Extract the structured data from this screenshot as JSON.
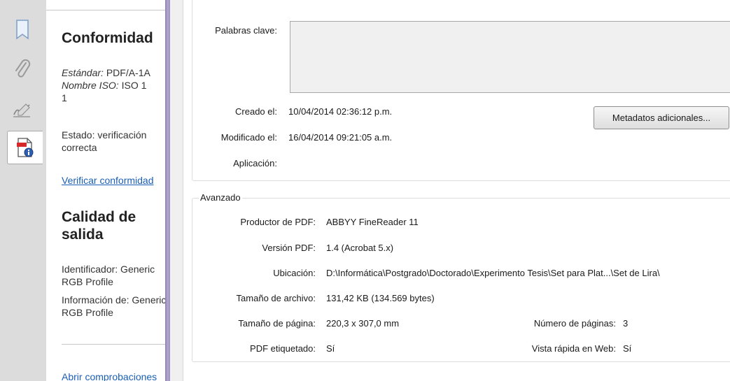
{
  "sidebar_panel": {
    "conformity_title": "Conformidad",
    "standard_label": "Estándar:",
    "standard_value": " PDF/A-1A",
    "iso_label": "Nombre ISO:",
    "iso_value": " ISO 1",
    "iso_cont": "1",
    "status_line1": "Estado: verificación",
    "status_line2": "correcta",
    "verify_link": "Verificar conformidad",
    "quality_title_l1": "Calidad de",
    "quality_title_l2": "salida",
    "identifier_l1": "Identificador: Generic",
    "identifier_l2": "RGB Profile",
    "info_l1": "Información de: Generic",
    "info_l2": "RGB Profile",
    "open_checks_link": "Abrir comprobaciones"
  },
  "properties": {
    "keywords_label": "Palabras clave:",
    "created_label": "Creado el:",
    "created_value": "10/04/2014 02:36:12 p.m.",
    "modified_label": "Modificado el:",
    "modified_value": "16/04/2014 09:21:05 a.m.",
    "application_label": "Aplicación:",
    "application_value": "",
    "more_metadata_button": "Metadatos adicionales...",
    "advanced_legend": "Avanzado",
    "producer_label": "Productor de PDF:",
    "producer_value": "ABBYY FineReader 11",
    "version_label": "Versión PDF:",
    "version_value": "1.4 (Acrobat 5.x)",
    "location_label": "Ubicación:",
    "location_value": "D:\\Informática\\Postgrado\\Doctorado\\Experimento Tesis\\Set para Plat...\\Set de Lira\\",
    "filesize_label": "Tamaño de archivo:",
    "filesize_value": "131,42 KB (134.569 bytes)",
    "pagesize_label": "Tamaño de página:",
    "pagesize_value": "220,3 x 307,0 mm",
    "pages_label": "Número de páginas:",
    "pages_value": "3",
    "tagged_label": "PDF etiquetado:",
    "tagged_value": "Sí",
    "fastweb_label": "Vista rápida en Web:",
    "fastweb_value": "Sí"
  },
  "icons": [
    "bookmark-icon",
    "paperclip-icon",
    "signature-icon",
    "document-info-icon"
  ]
}
